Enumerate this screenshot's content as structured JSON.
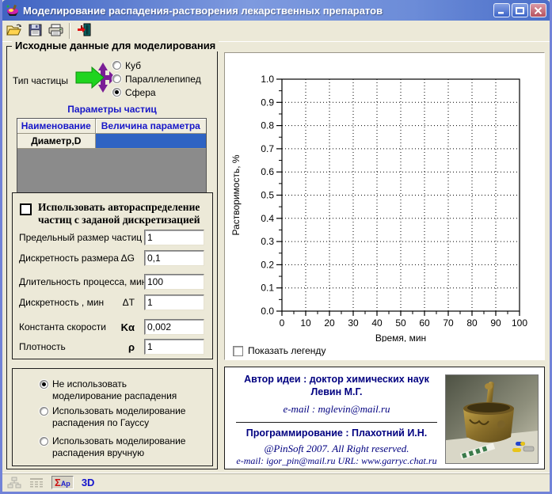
{
  "window": {
    "title": "Моделирование распадения-растворения лекарственных препаратов",
    "controls": {
      "minimize": "minimize",
      "maximize": "maximize",
      "close": "close"
    }
  },
  "toolbar": {
    "buttons": [
      {
        "name": "open-file-button",
        "icon": "open-folder-icon"
      },
      {
        "name": "save-button",
        "icon": "save-floppy-icon"
      },
      {
        "name": "print-button",
        "icon": "printer-icon"
      },
      {
        "name": "exit-button",
        "icon": "exit-door-icon"
      }
    ]
  },
  "input_group": {
    "title": "Исходные данные для моделирования",
    "particle_type": {
      "label": "Тип частицы",
      "icon": "branching-arrows-icon",
      "options": [
        {
          "label": "Куб",
          "selected": false
        },
        {
          "label": "Параллелепипед",
          "selected": false
        },
        {
          "label": "Сфера",
          "selected": true
        }
      ]
    },
    "params_table": {
      "title": "Параметры частиц",
      "headers": [
        "Наименование",
        "Величина параметра"
      ],
      "rows": [
        {
          "name": "Диаметр,D",
          "value": ""
        }
      ]
    },
    "auto_dist": {
      "label": "Использовать автораспределение частиц с заданой дискретизацией",
      "checked": false
    },
    "fields": [
      {
        "label": "Предельный размер частиц G",
        "symbol": "",
        "value": "1",
        "bold_symbol": false
      },
      {
        "label": "Дискретность размера",
        "symbol": "ΔG",
        "value": "0,1",
        "bold_symbol": false
      },
      {
        "label": "Длительность процесса, мин",
        "symbol": "",
        "value": "100",
        "bold_symbol": false
      },
      {
        "label": "Дискретность , мин",
        "symbol": "ΔT",
        "value": "1",
        "bold_symbol": false
      },
      {
        "label": "Константа скорости",
        "symbol": "Kα",
        "value": "0,002",
        "bold_symbol": true
      },
      {
        "label": "Плотность",
        "symbol": "ρ",
        "value": "1",
        "bold_symbol": true
      }
    ],
    "decay_options": [
      {
        "label": "Не использовать моделирование распадения",
        "selected": true
      },
      {
        "label": "Использовать моделирование распадения по Гауссу",
        "selected": false
      },
      {
        "label": "Использовать моделирование распадения вручную",
        "selected": false
      }
    ]
  },
  "chart_data": {
    "type": "line",
    "title": "",
    "xlabel": "Время, мин",
    "ylabel": "Растворимость, %",
    "xlim": [
      0,
      100
    ],
    "ylim": [
      0.0,
      1.0
    ],
    "x_ticks": [
      0,
      10,
      20,
      30,
      40,
      50,
      60,
      70,
      80,
      90,
      100
    ],
    "y_ticks": [
      0.0,
      0.1,
      0.2,
      0.3,
      0.4,
      0.5,
      0.6,
      0.7,
      0.8,
      0.9,
      1.0
    ],
    "x_minor_step": 5,
    "y_minor_step": 0.05,
    "grid": "dotted",
    "legend_visible": false,
    "series": []
  },
  "legend_checkbox": {
    "label": "Показать легенду",
    "checked": false
  },
  "about": {
    "author_line1": "Автор идеи :  доктор химических наук",
    "author_line2": "Левин М.Г.",
    "author_email": "e-mail :  mglevin@mail.ru",
    "programming": "Программирование :  Плахотний И.Н.",
    "copyright": "@PinSoft 2007. All  Right   reserved.",
    "contacts": "e-mail: igor_pin@mail.ru    URL: www.garryc.chat.ru",
    "photo": "mortar-and-pestle-photo"
  },
  "statusbar": {
    "icons": [
      "tree-icon",
      "grid-icon"
    ],
    "sigma_label": "Σ",
    "ap_label": "Ар",
    "threed_label": "3D"
  },
  "colors": {
    "titlebar_blue": "#4A6EC8",
    "window_border": "#7283D8",
    "panel_beige": "#ECE9D8",
    "selected_cell_blue": "#2E63C3",
    "table_text_blue": "#1717C8",
    "navy_text": "#000080",
    "gray_filler": "#8B8B8B"
  }
}
